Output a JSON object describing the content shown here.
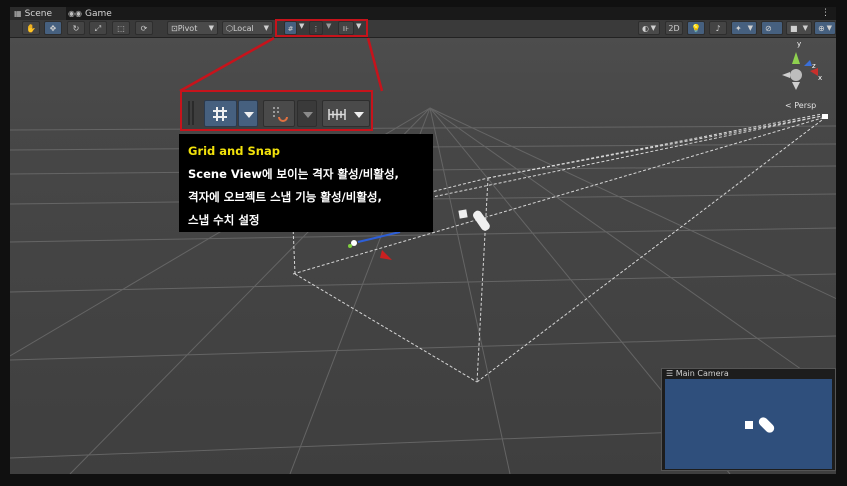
{
  "tabs": [
    {
      "label": "Scene",
      "icon": "grid-icon"
    },
    {
      "label": "Game",
      "icon": "gamepad-icon"
    }
  ],
  "toolbar": {
    "pivot_label": "Pivot",
    "local_label": "Local",
    "twod_label": "2D"
  },
  "scene": {
    "persp_label": "< Persp",
    "gizmo": {
      "x": "x",
      "y": "y",
      "z": "z"
    }
  },
  "callout": {
    "title": "Grid and Snap",
    "lines": [
      "Scene View에 보이는 격자 활성/비활성,",
      "격자에 오브젝트 스냅 기능 활성/비활성,",
      "스냅 수치 설정"
    ]
  },
  "camera_preview": {
    "title": "Main Camera"
  },
  "colors": {
    "highlight": "#c7131b",
    "callout_title": "#f2e20b",
    "accent": "#46607f"
  }
}
